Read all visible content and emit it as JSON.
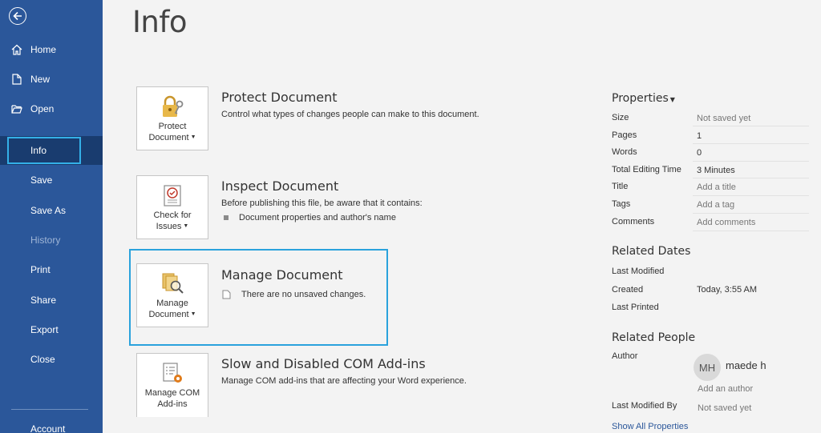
{
  "sidebar": {
    "items": [
      {
        "label": "Home",
        "icon": "home-icon"
      },
      {
        "label": "New",
        "icon": "new-document-icon"
      },
      {
        "label": "Open",
        "icon": "folder-open-icon"
      },
      {
        "label": "Info"
      },
      {
        "label": "Save"
      },
      {
        "label": "Save As"
      },
      {
        "label": "History"
      },
      {
        "label": "Print"
      },
      {
        "label": "Share"
      },
      {
        "label": "Export"
      },
      {
        "label": "Close"
      },
      {
        "label": "Account"
      }
    ]
  },
  "page_title": "Info",
  "sections": [
    {
      "button": {
        "line1": "Protect",
        "line2": "Document",
        "icon": "lock-key-icon"
      },
      "title": "Protect Document",
      "desc": "Control what types of changes people can make to this document."
    },
    {
      "button": {
        "line1": "Check for",
        "line2": "Issues",
        "icon": "inspect-checklist-icon"
      },
      "title": "Inspect Document",
      "desc": "Before publishing this file, be aware that it contains:",
      "bullet": "Document properties and author's name"
    },
    {
      "button": {
        "line1": "Manage",
        "line2": "Document",
        "icon": "manage-document-icon"
      },
      "title": "Manage Document",
      "desc": "There are no unsaved changes."
    },
    {
      "button": {
        "line1": "Manage COM",
        "line2": "Add-ins",
        "icon": "addins-gear-icon"
      },
      "title": "Slow and Disabled COM Add-ins",
      "desc": "Manage COM add-ins that are affecting your Word experience."
    }
  ],
  "properties": {
    "heading": "Properties",
    "rows": [
      {
        "key": "Size",
        "value": "Not saved yet"
      },
      {
        "key": "Pages",
        "value": "1"
      },
      {
        "key": "Words",
        "value": "0"
      },
      {
        "key": "Total Editing Time",
        "value": "3 Minutes"
      },
      {
        "key": "Title",
        "value": "Add a title"
      },
      {
        "key": "Tags",
        "value": "Add a tag"
      },
      {
        "key": "Comments",
        "value": "Add comments"
      }
    ]
  },
  "related_dates": {
    "heading": "Related Dates",
    "rows": [
      {
        "key": "Last Modified",
        "value": ""
      },
      {
        "key": "Created",
        "value": "Today, 3:55 AM"
      },
      {
        "key": "Last Printed",
        "value": ""
      }
    ]
  },
  "related_people": {
    "heading": "Related People",
    "author_label": "Author",
    "author_initials": "MH",
    "author_name": "maede h",
    "add_author": "Add an author",
    "last_modified_by_label": "Last Modified By",
    "last_modified_by_value": "Not saved yet"
  },
  "show_all": "Show All Properties",
  "colors": {
    "sidebar": "#2b579a",
    "highlight": "#2aa2dc",
    "background": "#f3f3f3"
  }
}
